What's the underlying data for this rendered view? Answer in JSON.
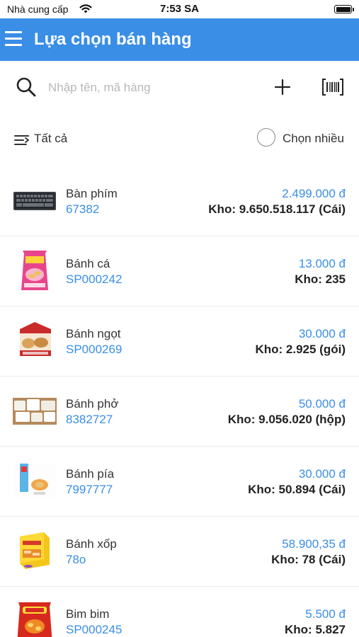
{
  "status_bar": {
    "carrier": "Nhà cung cấp",
    "time": "7:53 SA"
  },
  "header": {
    "title": "Lựa chọn bán hàng",
    "color": "#3a8ee6"
  },
  "search": {
    "placeholder": "Nhập tên, mã hàng"
  },
  "filter": {
    "label": "Tất cả",
    "multi_select_label": "Chọn nhiều"
  },
  "products": [
    {
      "name": "Bàn phím",
      "code": "67382",
      "price": "2.499.000 đ",
      "stock": "Kho: 9.650.518.117 (Cái)",
      "thumbnail": "keyboard"
    },
    {
      "name": "Bánh cá",
      "code": "SP000242",
      "price": "13.000 đ",
      "stock": "Kho: 235",
      "thumbnail": "pink-snack-bag"
    },
    {
      "name": "Bánh ngọt",
      "code": "SP000269",
      "price": "30.000 đ",
      "stock": "Kho: 2.925 (gói)",
      "thumbnail": "cake-package"
    },
    {
      "name": "Bánh phở",
      "code": "8382727",
      "price": "50.000 đ",
      "stock": "Kho: 9.056.020 (hộp)",
      "thumbnail": "rice-noodle-rolls"
    },
    {
      "name": "Bánh pía",
      "code": "7997777",
      "price": "30.000 đ",
      "stock": "Kho: 50.894 (Cái)",
      "thumbnail": "pia-cake-box"
    },
    {
      "name": "Bánh xốp",
      "code": "78o",
      "price": "58.900,35 đ",
      "stock": "Kho: 78 (Cái)",
      "thumbnail": "wafer-box"
    },
    {
      "name": "Bim bim",
      "code": "SP000245",
      "price": "5.500 đ",
      "stock": "Kho: 5.827",
      "thumbnail": "chips-bag"
    }
  ]
}
